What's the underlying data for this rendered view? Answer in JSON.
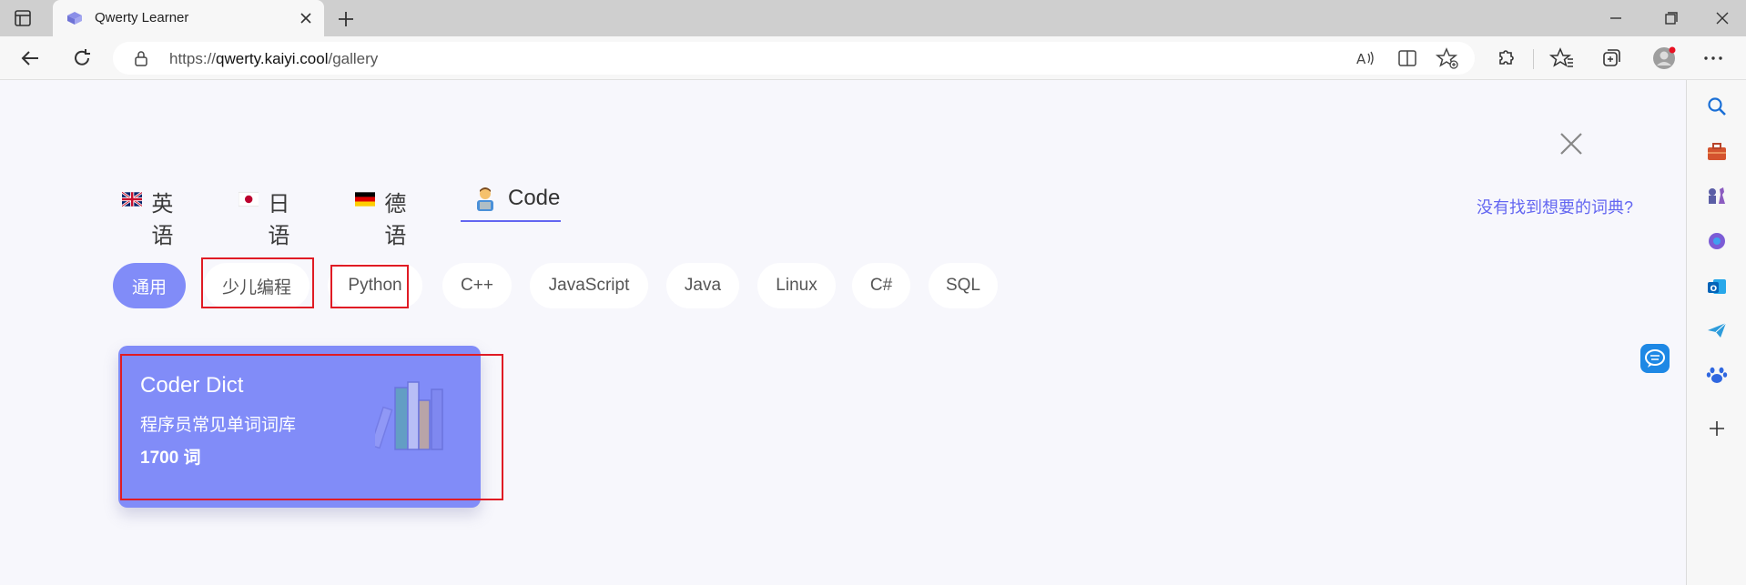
{
  "browser": {
    "tab_title": "Qwerty Learner",
    "url_host": "qwerty.kaiyi.cool",
    "url_prefix": "https://",
    "url_path": "/gallery"
  },
  "page": {
    "languages": [
      {
        "flag": "uk-flag-icon",
        "label": "英语"
      },
      {
        "flag": "japan-flag-icon",
        "label": "日语"
      },
      {
        "flag": "germany-flag-icon",
        "label": "德语"
      },
      {
        "flag": "coder-emoji-icon",
        "label": "Code",
        "active": true
      }
    ],
    "missing_dict_link": "没有找到想要的词典?",
    "categories": [
      "通用",
      "少儿编程",
      "Python",
      "C++",
      "JavaScript",
      "Java",
      "Linux",
      "C#",
      "SQL"
    ],
    "active_category": "通用",
    "dict_card": {
      "name": "Coder Dict",
      "description": "程序员常见单词词库",
      "count": "1700 词"
    }
  },
  "colors": {
    "accent": "#6366f1",
    "card_bg": "#818cf8",
    "highlight_box": "#e01b24"
  }
}
